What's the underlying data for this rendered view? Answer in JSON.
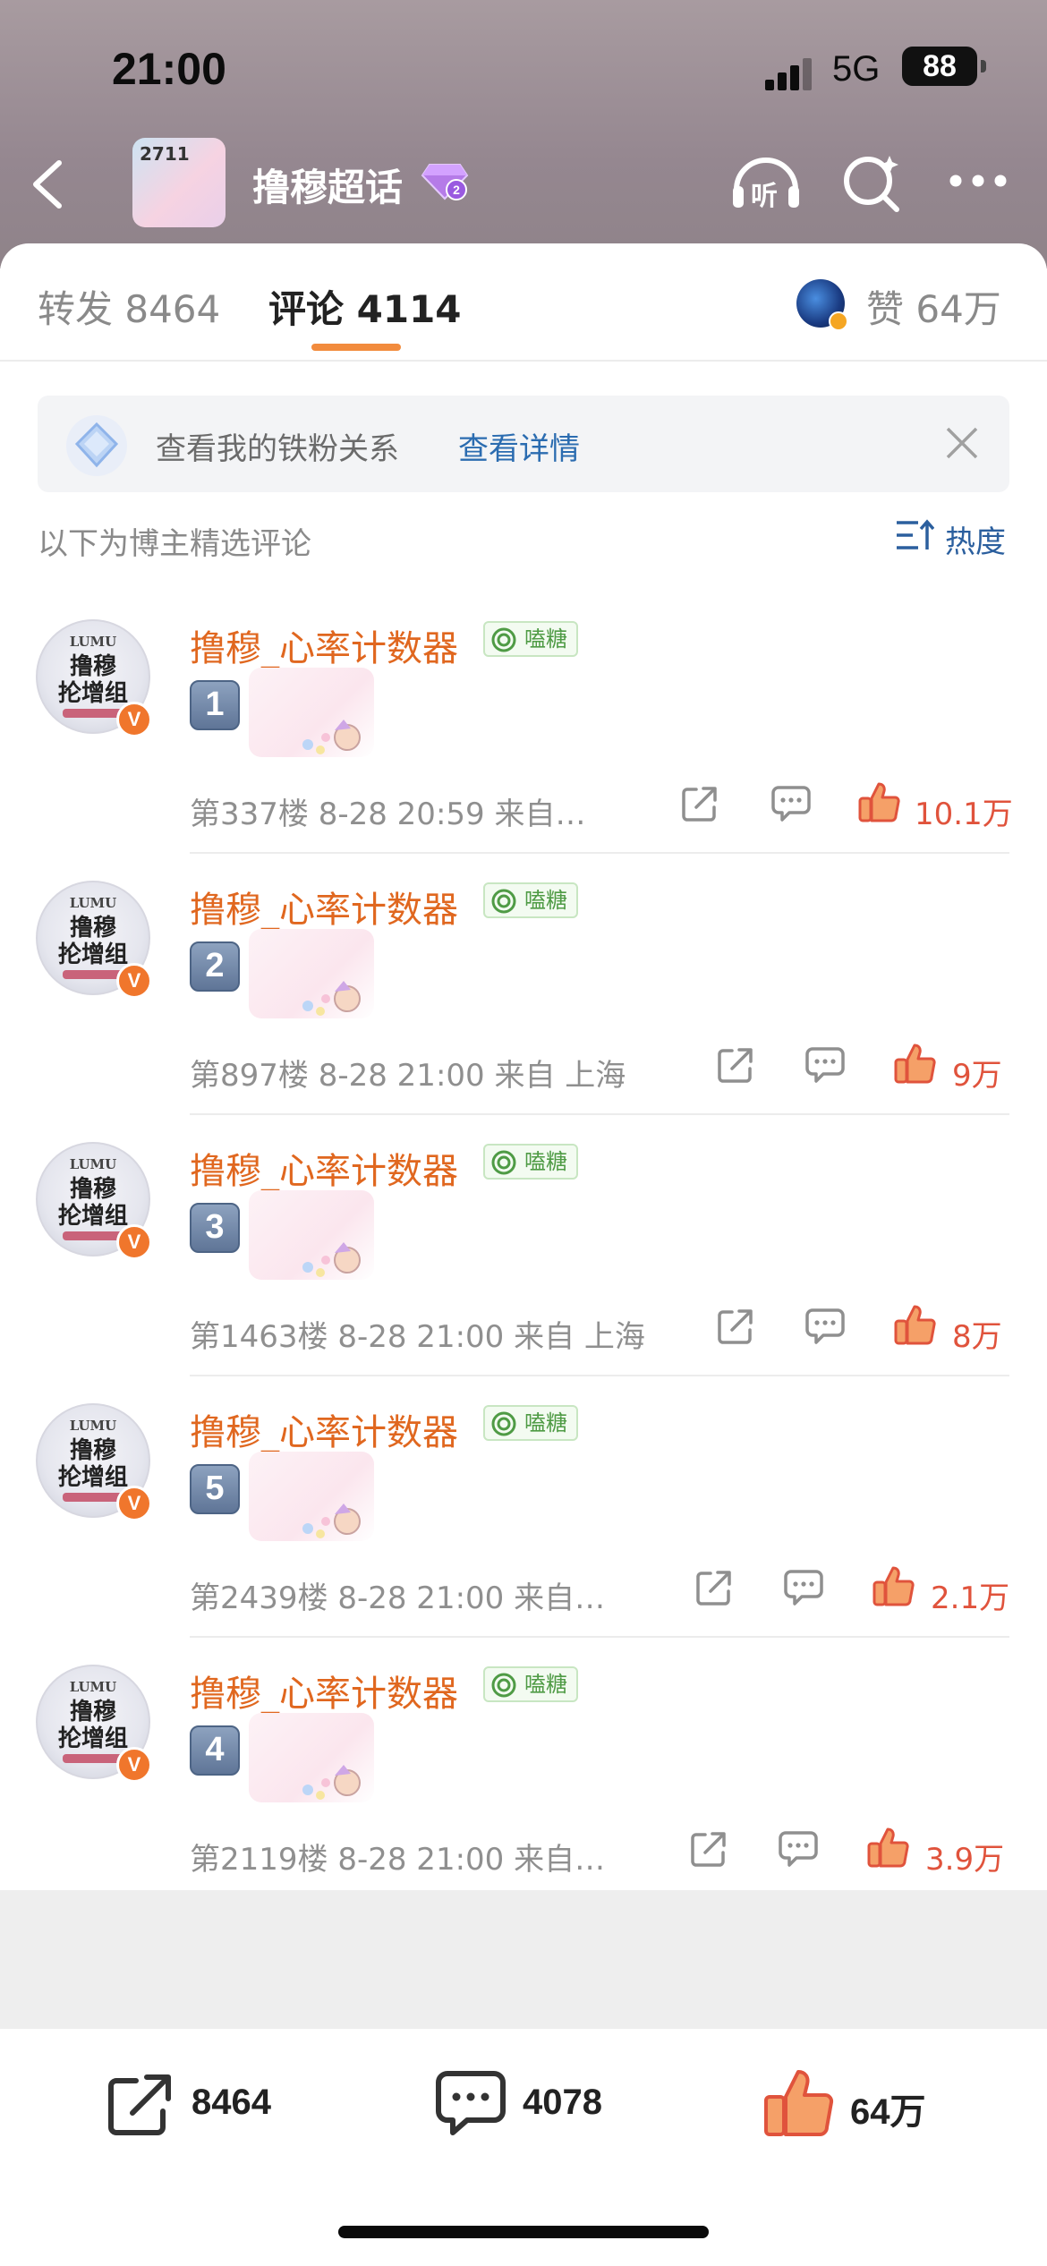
{
  "status_bar": {
    "time": "21:00",
    "network": "5G",
    "battery": "88"
  },
  "nav": {
    "title": "撸穆超话",
    "topic_image_text": "2711",
    "listen_label": "听"
  },
  "tabs": {
    "repost_label": "转发 8464",
    "comment_label": "评论 4114",
    "like_label": "赞 64万"
  },
  "fan_banner": {
    "text": "查看我的铁粉关系",
    "link": "查看详情"
  },
  "section": {
    "note": "以下为博主精选评论",
    "sort_label": "热度"
  },
  "avatar": {
    "top_text": "LUMU",
    "main_text": "撸穆\n抡增组"
  },
  "comments": [
    {
      "name": "撸穆_心率计数器",
      "tag": "嗑糖",
      "number": "1",
      "meta": "第337楼 8-28 20:59 来自…",
      "likes": "10.1万"
    },
    {
      "name": "撸穆_心率计数器",
      "tag": "嗑糖",
      "number": "2",
      "meta": "第897楼 8-28 21:00 来自 上海",
      "likes": "9万"
    },
    {
      "name": "撸穆_心率计数器",
      "tag": "嗑糖",
      "number": "3",
      "meta": "第1463楼 8-28 21:00 来自 上海",
      "likes": "8万"
    },
    {
      "name": "撸穆_心率计数器",
      "tag": "嗑糖",
      "number": "5",
      "meta": "第2439楼 8-28 21:00 来自…",
      "likes": "2.1万"
    },
    {
      "name": "撸穆_心率计数器",
      "tag": "嗑糖",
      "number": "4",
      "meta": "第2119楼 8-28 21:00 来自…",
      "likes": "3.9万"
    }
  ],
  "bottom_bar": {
    "repost_count": "8464",
    "comment_count": "4078",
    "like_count": "64万"
  },
  "colors": {
    "accent_orange": "#e0671f",
    "like_red": "#e0533c",
    "link_blue": "#2b6cb0",
    "tab_underline": "#f28b3d"
  },
  "icons": [
    "back-icon",
    "listen-icon",
    "search-icon",
    "more-icon",
    "fan-icon",
    "close-icon",
    "sort-icon",
    "share-icon",
    "comment-icon",
    "like-icon"
  ]
}
